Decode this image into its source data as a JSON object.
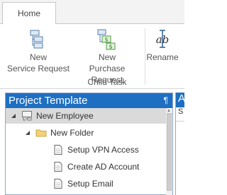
{
  "ribbon": {
    "tabs": [
      {
        "label": "Home"
      }
    ],
    "buttons": {
      "new_service_request": {
        "line1": "New",
        "line2": "Service Request",
        "icon": "service-request-icon"
      },
      "new_purchase_request": {
        "line1": "New",
        "line2": "Purchase Request",
        "icon": "purchase-request-icon"
      },
      "rename": {
        "label": "Rename",
        "icon": "rename-icon"
      }
    },
    "group_label": "Child Task"
  },
  "project_template_pane": {
    "title": "Project Template",
    "pin_glyph": "¶",
    "tree": [
      {
        "label": "New Employee",
        "level": 0,
        "selected": true,
        "icon": "template-icon",
        "expanded": true
      },
      {
        "label": "New Folder",
        "level": 1,
        "selected": false,
        "icon": "folder-icon",
        "expanded": true
      },
      {
        "label": "Setup VPN Access",
        "level": 2,
        "selected": false,
        "icon": "document-icon"
      },
      {
        "label": "Create AD Account",
        "level": 2,
        "selected": false,
        "icon": "document-icon"
      },
      {
        "label": "Setup Email",
        "level": 2,
        "selected": false,
        "icon": "document-icon"
      }
    ]
  },
  "second_pane": {
    "title_fragment": "A",
    "sub_fragment": "S"
  },
  "colors": {
    "pane_header": "#1e6fc2",
    "selection": "#dadada",
    "folder": "#f3d27a",
    "accent_green": "#4b9a3f"
  }
}
